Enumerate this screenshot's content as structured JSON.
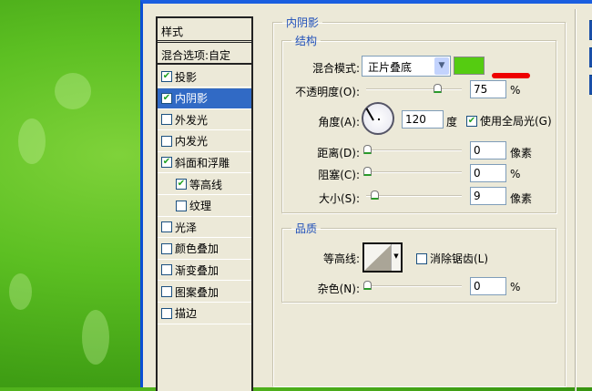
{
  "styles_list": {
    "header": "样式",
    "blend_options": "混合选项:自定",
    "items": [
      {
        "label": "投影",
        "checked": true
      },
      {
        "label": "内阴影",
        "checked": true,
        "selected": true
      },
      {
        "label": "外发光",
        "checked": false
      },
      {
        "label": "内发光",
        "checked": false
      },
      {
        "label": "斜面和浮雕",
        "checked": true
      },
      {
        "label": "等高线",
        "checked": true,
        "indent": true
      },
      {
        "label": "纹理",
        "checked": false,
        "indent": true
      },
      {
        "label": "光泽",
        "checked": false
      },
      {
        "label": "颜色叠加",
        "checked": false
      },
      {
        "label": "渐变叠加",
        "checked": false
      },
      {
        "label": "图案叠加",
        "checked": false
      },
      {
        "label": "描边",
        "checked": false
      }
    ]
  },
  "inner_shadow": {
    "title": "内阴影",
    "structure": {
      "title": "结构",
      "blend_mode_label": "混合模式:",
      "blend_mode_value": "正片叠底",
      "shadow_color": "#55cc11",
      "opacity_label": "不透明度(O):",
      "opacity_value": "75",
      "opacity_unit": "%",
      "opacity_fraction": 0.75,
      "angle_label": "角度(A):",
      "angle_value": "120",
      "angle_unit": "度",
      "global_light_label": "使用全局光(G)",
      "global_light_checked": true,
      "distance_label": "距离(D):",
      "distance_value": "0",
      "distance_unit": "像素",
      "choke_label": "阻塞(C):",
      "choke_value": "0",
      "choke_unit": "%",
      "size_label": "大小(S):",
      "size_value": "9",
      "size_unit": "像素"
    },
    "quality": {
      "title": "品质",
      "contour_label": "等高线:",
      "anti_alias_label": "消除锯齿(L)",
      "anti_alias_checked": false,
      "noise_label": "杂色(N):",
      "noise_value": "0",
      "noise_unit": "%"
    }
  },
  "colors": {
    "annotation_mark": "#ee0000",
    "selection": "#316ac5"
  }
}
